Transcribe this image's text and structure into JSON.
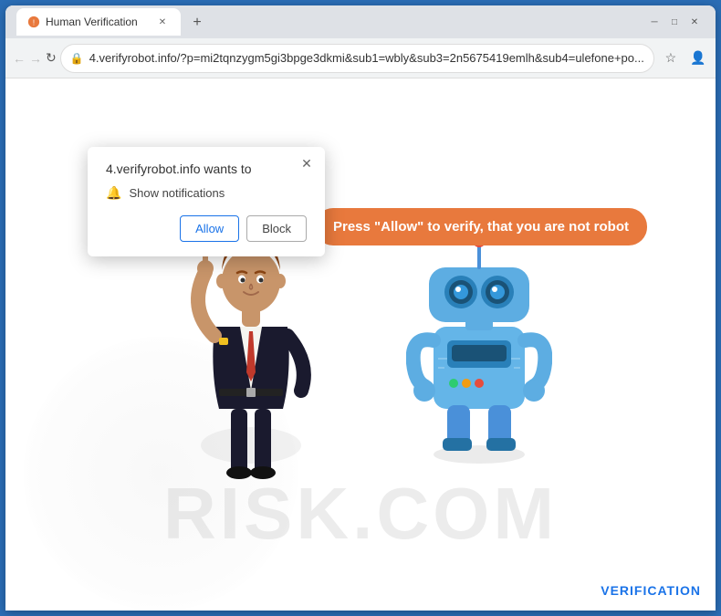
{
  "browser": {
    "tab_title": "Human Verification",
    "url": "4.verifyrobot.info/?p=mi2tqnzygm5gi3bpge3dkmi&sub1=wbly&sub3=2n5675419emlh&sub4=ulefone+po...",
    "url_display": "4.verifyrobot.info/?p=mi2tqnzygm5gi3bpge3dkmi&sub1=wbly&sub3=2n5675419emlh&sub4=ulefone+po..."
  },
  "popup": {
    "title": "4.verifyrobot.info wants to",
    "notification_label": "Show notifications",
    "allow_btn": "Allow",
    "block_btn": "Block"
  },
  "page": {
    "speech_text": "Press \"Allow\" to verify, that you are not robot",
    "watermark": "RISK.COM",
    "verification_label": "VERIFICATION"
  },
  "icons": {
    "back": "←",
    "forward": "→",
    "reload": "↻",
    "lock": "🔒",
    "star": "☆",
    "profile": "👤",
    "menu": "⋮",
    "close": "✕",
    "plus": "+",
    "bell": "🔔"
  }
}
